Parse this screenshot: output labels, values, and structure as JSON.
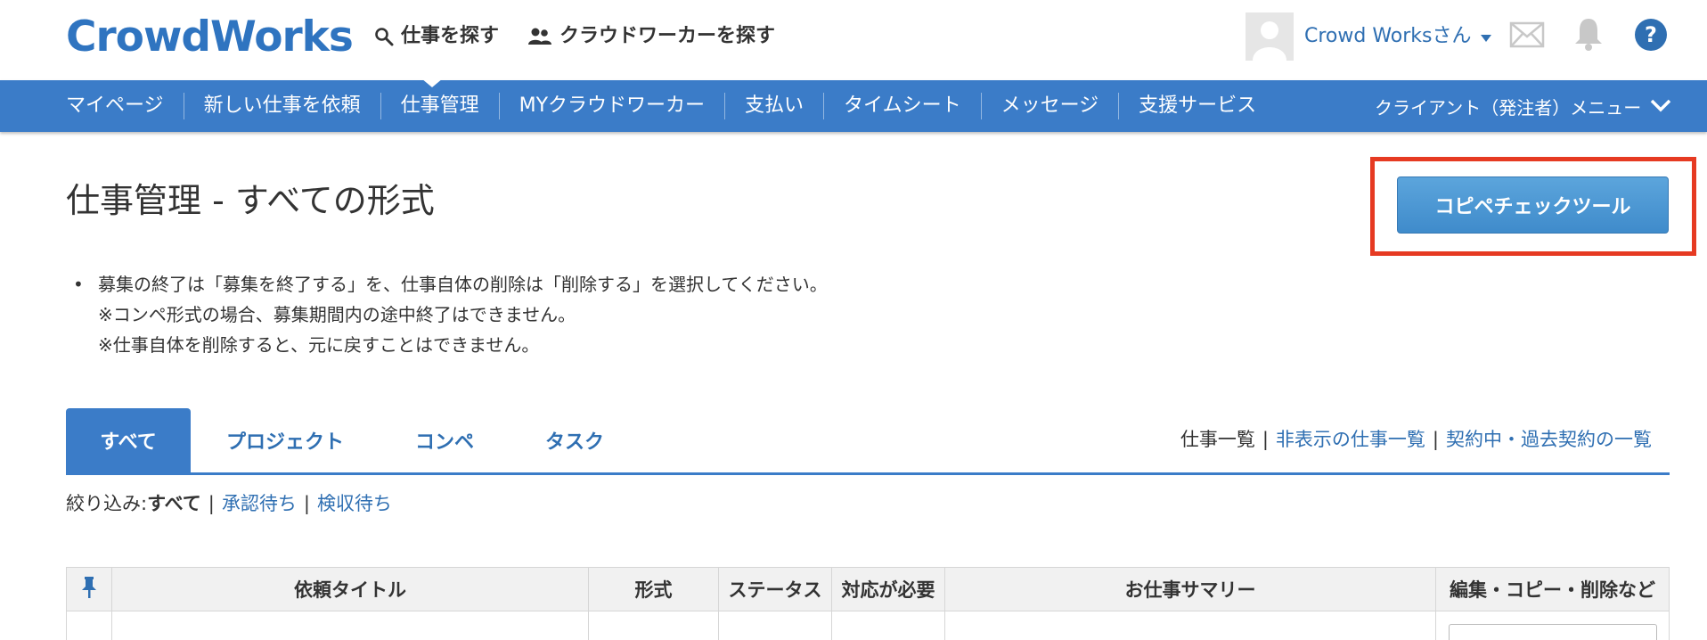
{
  "header": {
    "logo": "CrowdWorks",
    "search_jobs": "仕事を探す",
    "search_workers": "クラウドワーカーを探す",
    "user_name": "Crowd Worksさん",
    "icons": [
      "search-icon",
      "people-icon",
      "avatar",
      "chevron-down-icon",
      "mail-icon",
      "bell-icon",
      "help-icon"
    ]
  },
  "nav": {
    "items": [
      "マイページ",
      "新しい仕事を依頼",
      "仕事管理",
      "MYクラウドワーカー",
      "支払い",
      "タイムシート",
      "メッセージ",
      "支援サービス"
    ],
    "active": "仕事管理",
    "client_menu": "クライアント（発注者）メニュー"
  },
  "page": {
    "title": "仕事管理 - すべての形式",
    "copipe_button": "コピペチェックツール",
    "notes": [
      "募集の終了は「募集を終了する」を、仕事自体の削除は「削除する」を選択してください。",
      "※コンペ形式の場合、募集期間内の途中終了はできません。",
      "※仕事自体を削除すると、元に戻すことはできません。"
    ]
  },
  "tabs": {
    "items": [
      "すべて",
      "プロジェクト",
      "コンペ",
      "タスク"
    ],
    "active": "すべて"
  },
  "list_links": {
    "current": "仕事一覧",
    "hidden_jobs": "非表示の仕事一覧",
    "contracts": "契約中・過去契約の一覧",
    "separator": "|"
  },
  "filter": {
    "label": "絞り込み:",
    "current": "すべて",
    "options": [
      "承認待ち",
      "検収待ち"
    ],
    "separator": "|"
  },
  "table": {
    "columns": [
      "",
      "依頼タイトル",
      "形式",
      "ステータス",
      "対応が必要",
      "お仕事サマリー",
      "編集・コピー・削除など"
    ]
  },
  "colors": {
    "brand_blue": "#3b7cc8",
    "link_blue": "#2f6fb2",
    "highlight_red": "#e63a22"
  }
}
